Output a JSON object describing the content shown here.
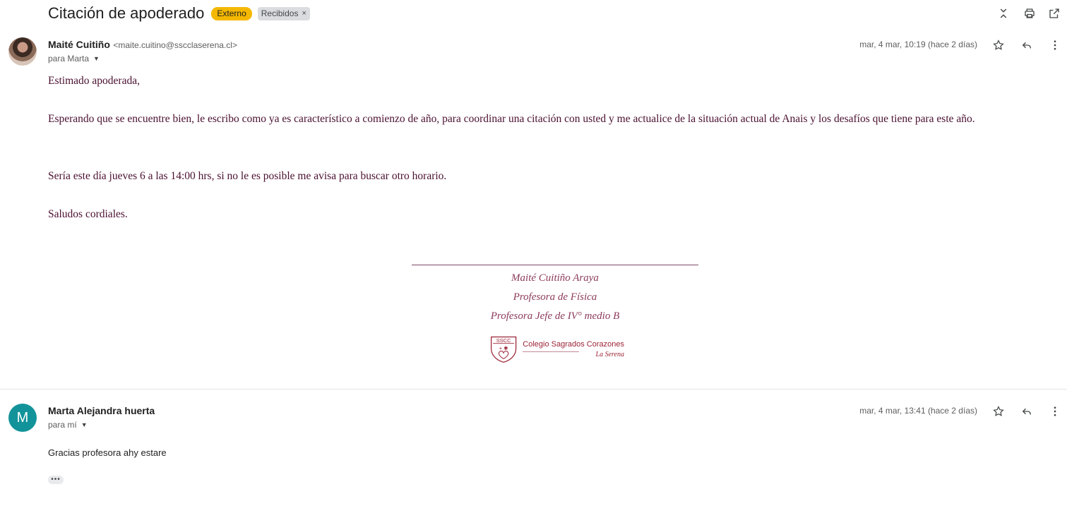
{
  "thread": {
    "subject": "Citación de apoderado",
    "labels": {
      "external": "Externo",
      "inbox": "Recibidos",
      "inbox_remove": "×"
    },
    "top_actions": [
      "collapse-all-icon",
      "print-icon",
      "open-in-new-window-icon"
    ]
  },
  "message1": {
    "sender_name": "Maité Cuitiño",
    "sender_email": "<maite.cuitino@sscclaserena.cl>",
    "to": "para Marta",
    "date": "mar, 4 mar, 10:19 (hace 2 días)",
    "greeting": "Estimado apoderada,",
    "paragraph1": "Esperando que se encuentre bien,  le escribo como ya es característico a comienzo de año, para coordinar una citación con usted y me actualice de la situación actual de Anais y los desafíos que tiene para este año.",
    "paragraph2": "Sería este día jueves 6 a las 14:00 hrs, si no le es posible me avisa para buscar otro horario.",
    "closing": "Saludos cordiales.",
    "signature": {
      "name": "Maité Cuitiño Araya",
      "role1": "Profesora de Física",
      "role2": "Profesora Jefe de IV° medio B",
      "logo_acronym": "SSCC",
      "logo_name": "Colegio Sagrados Corazones",
      "logo_city": "La Serena"
    }
  },
  "message2": {
    "avatar_letter": "M",
    "sender_name": "Marta Alejandra huerta",
    "to": "para mí",
    "date": "mar, 4 mar, 13:41 (hace 2 días)",
    "body": "Gracias profesora ahy estare",
    "show_trimmed": "•••"
  },
  "colors": {
    "external_label": "#f5b800",
    "inbox_label": "#dadce0",
    "avatar_m": "#12939a",
    "body_text": "#4a1030",
    "signature_text": "#8c3a5a",
    "logo": "#9b2335"
  }
}
